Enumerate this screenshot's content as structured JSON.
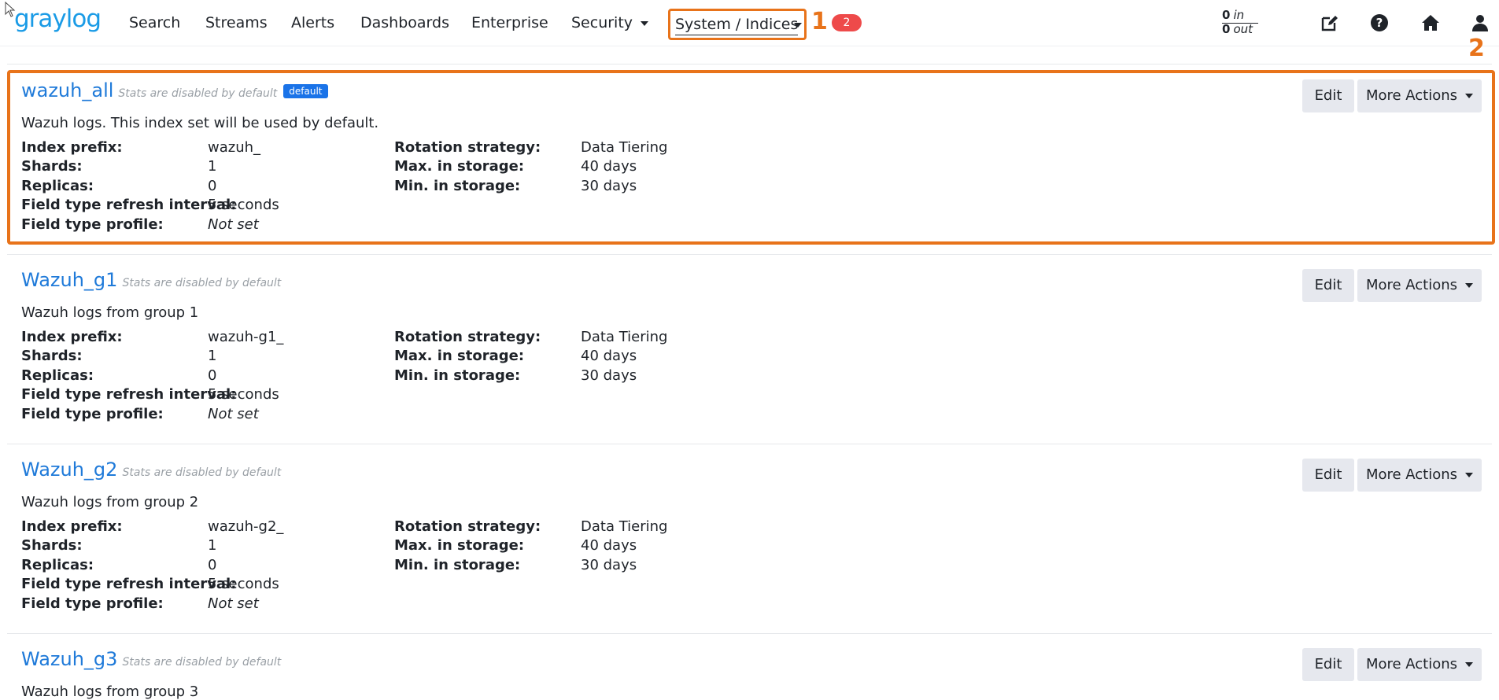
{
  "nav": {
    "logo": "graylog",
    "items": [
      "Search",
      "Streams",
      "Alerts",
      "Dashboards",
      "Enterprise",
      "Security"
    ],
    "active_item": "System / Indices",
    "notification_count": "2",
    "throughput": {
      "in_count": "0",
      "in_label": "in",
      "out_count": "0",
      "out_label": "out"
    },
    "icons": [
      "edit-icon",
      "help-icon",
      "home-icon",
      "user-icon"
    ]
  },
  "markers": {
    "first": "1",
    "second": "2"
  },
  "colors": {
    "accent": "#e8731a",
    "link": "#1f7ad9",
    "badge": "#ee4a4a",
    "default_tag": "#1a73e8"
  },
  "labels": {
    "index_prefix": "Index prefix:",
    "shards": "Shards:",
    "replicas": "Replicas:",
    "refresh_interval": "Field type refresh interval:",
    "field_profile": "Field type profile:",
    "rotation": "Rotation strategy:",
    "max_storage": "Max. in storage:",
    "min_storage": "Min. in storage:",
    "stats_note": "Stats are disabled by default",
    "default_tag": "default",
    "edit": "Edit",
    "more_actions": "More Actions"
  },
  "index_sets": [
    {
      "title": "wazuh_all",
      "description": "Wazuh logs. This index set will be used by default.",
      "prefix": "wazuh_",
      "shards": "1",
      "replicas": "0",
      "refresh": "5 seconds",
      "profile": "Not set",
      "rotation": "Data Tiering",
      "max": "40 days",
      "min": "30 days"
    },
    {
      "title": "Wazuh_g1",
      "description": "Wazuh logs from group 1",
      "prefix": "wazuh-g1_",
      "shards": "1",
      "replicas": "0",
      "refresh": "5 seconds",
      "profile": "Not set",
      "rotation": "Data Tiering",
      "max": "40 days",
      "min": "30 days"
    },
    {
      "title": "Wazuh_g2",
      "description": "Wazuh logs from group 2",
      "prefix": "wazuh-g2_",
      "shards": "1",
      "replicas": "0",
      "refresh": "5 seconds",
      "profile": "Not set",
      "rotation": "Data Tiering",
      "max": "40 days",
      "min": "30 days"
    },
    {
      "title": "Wazuh_g3",
      "description": "Wazuh logs from group 3"
    }
  ]
}
